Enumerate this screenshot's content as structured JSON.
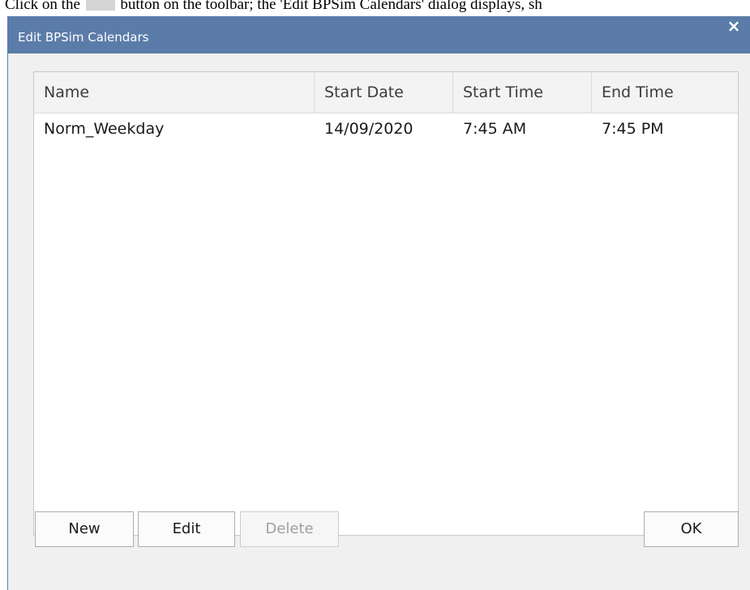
{
  "caption": {
    "before": "Click on the",
    "after": "button on the toolbar; the 'Edit BPSim Calendars' dialog displays, sh"
  },
  "dialog": {
    "title": "Edit BPSim Calendars",
    "close_glyph": "×"
  },
  "table": {
    "columns": [
      "Name",
      "Start Date",
      "Start Time",
      "End Time"
    ],
    "rows": [
      {
        "name": "Norm_Weekday",
        "start_date": "14/09/2020",
        "start_time": "7:45 AM",
        "end_time": "7:45 PM"
      }
    ]
  },
  "buttons": {
    "new": "New",
    "edit": "Edit",
    "delete": "Delete",
    "ok": "OK"
  },
  "colors": {
    "titlebar": "#5b7ca9",
    "dialog_bg": "#f0f0f0"
  },
  "icons": {
    "close": "close-icon",
    "toolbar_button": "toolbar-button-image"
  }
}
